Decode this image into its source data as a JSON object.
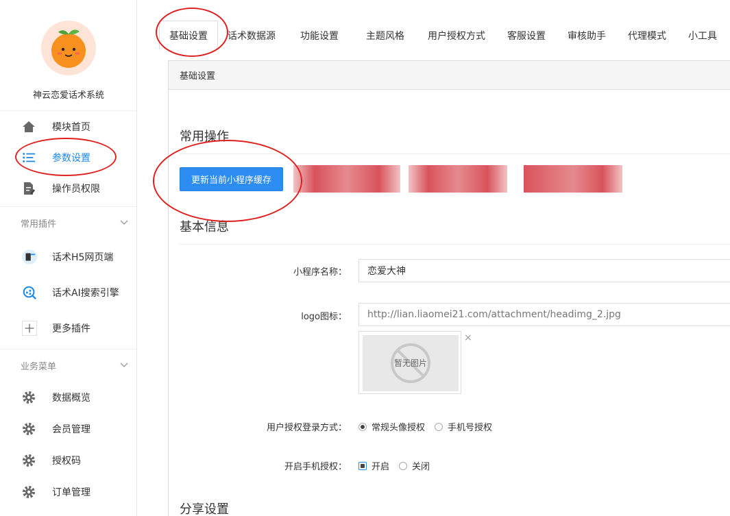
{
  "sidebar": {
    "brand_name": "神云恋爱话术系统",
    "nav": [
      {
        "label": "模块首页",
        "icon": "home-icon"
      },
      {
        "label": "参数设置",
        "icon": "settings-list-icon"
      },
      {
        "label": "操作员权限",
        "icon": "document-edit-icon"
      }
    ],
    "plugins_group": "常用插件",
    "plugins": [
      {
        "label": "话术H5网页端",
        "icon": "h5-page-icon"
      },
      {
        "label": "话术AI搜索引擎",
        "icon": "ai-search-icon"
      },
      {
        "label": "更多插件",
        "icon": "plus-icon"
      }
    ],
    "business_group": "业务菜单",
    "business": [
      {
        "label": "数据概览",
        "icon": "gear-icon"
      },
      {
        "label": "会员管理",
        "icon": "gear-icon"
      },
      {
        "label": "授权码",
        "icon": "gear-icon"
      },
      {
        "label": "订单管理",
        "icon": "gear-icon"
      }
    ]
  },
  "tabs": [
    "基础设置",
    "话术数据源",
    "功能设置",
    "主题风格",
    "用户授权方式",
    "客服设置",
    "审核助手",
    "代理模式",
    "小工具"
  ],
  "panel": {
    "header": "基础设置",
    "common_ops_title": "常用操作",
    "refresh_button": "更新当前小程序缓存",
    "basic_info_title": "基本信息",
    "app_name_label": "小程序名称：",
    "app_name_value": "恋爱大神",
    "logo_label": "logo图标：",
    "logo_value": "http://lian.liaomei21.com/attachment/headimg_2.jpg",
    "no_image_text": "暂无图片",
    "remove_glyph": "×",
    "login_mode_label": "用户授权登录方式：",
    "login_mode_options": [
      "常规头像授权",
      "手机号授权"
    ],
    "phone_auth_label": "开启手机授权：",
    "phone_auth_options": [
      "开启",
      "关闭"
    ],
    "share_title": "分享设置"
  },
  "colors": {
    "primary": "#2d8cf0",
    "active_nav": "#1e88e5",
    "annotation": "#e02020",
    "blur": "#d9535b"
  }
}
